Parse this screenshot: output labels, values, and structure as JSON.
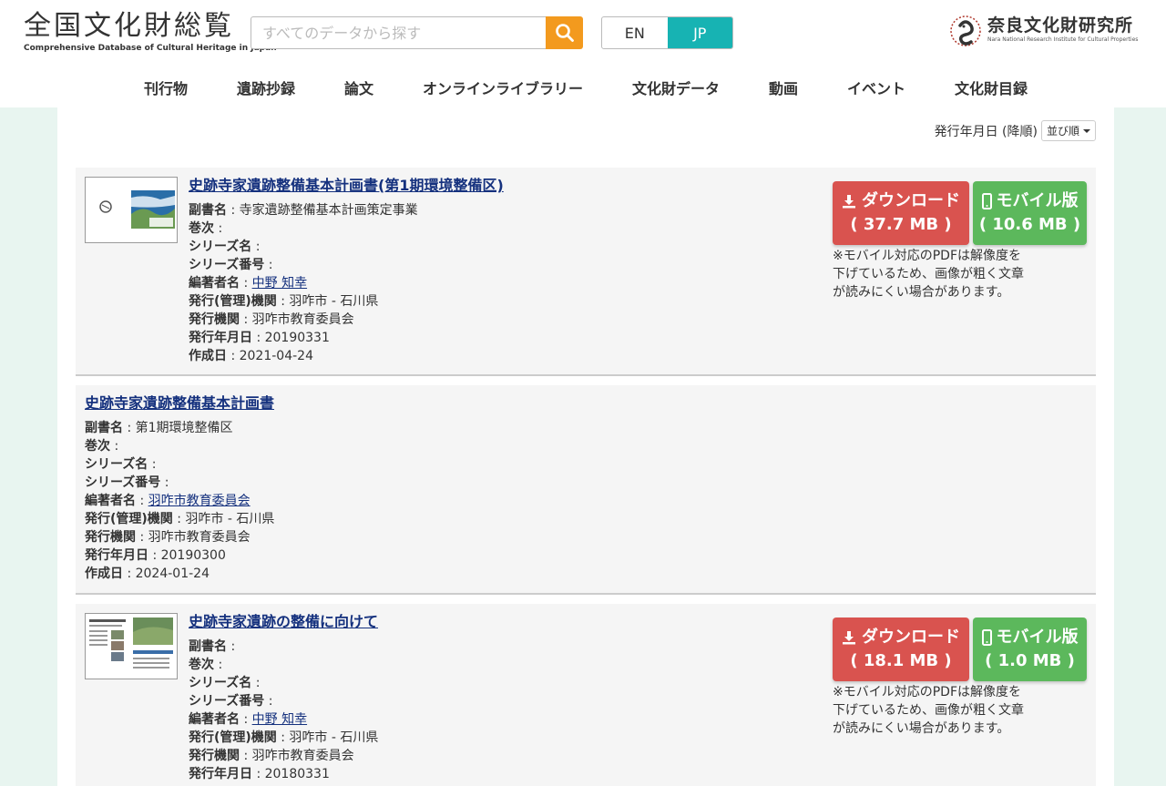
{
  "header": {
    "logo_title": "全国文化財総覧",
    "logo_subtitle": "Comprehensive Database of Cultural Heritage in Japan",
    "search_placeholder": "すべてのデータから探す",
    "lang_en": "EN",
    "lang_jp": "JP",
    "institute_name": "奈良文化財研究所",
    "institute_sub": "Nara National Research Institute for Cultural Properties"
  },
  "nav": [
    "刊行物",
    "遺跡抄録",
    "論文",
    "オンラインライブラリー",
    "文化財データ",
    "動画",
    "イベント",
    "文化財目録"
  ],
  "sort": {
    "label": "発行年月日 (降順)",
    "button": "並び順"
  },
  "field_labels": {
    "subtitle": "副書名",
    "volume": "巻次",
    "series": "シリーズ名",
    "series_no": "シリーズ番号",
    "author": "編著者名",
    "org": "発行(管理)機関",
    "publisher": "発行機関",
    "date": "発行年月日",
    "created": "作成日"
  },
  "download_label": "ダウンロード",
  "mobile_label": "モバイル版",
  "mobile_note": "※モバイル対応のPDFは解像度を下げているため、画像が粗く文章が読みにくい場合があります。",
  "results": [
    {
      "title": "史跡寺家遺跡整備基本計画書(第1期環境整備区)",
      "subtitle": " : 寺家遺跡整備基本計画策定事業",
      "volume": " :",
      "series": " :",
      "series_no": " :",
      "author": "中野 知幸",
      "org": " : 羽咋市 - 石川県",
      "publisher": " : 羽咋市教育委員会",
      "date": " : 20190331",
      "created": " : 2021-04-24",
      "download_size": "( 37.7 MB )",
      "mobile_size": "( 10.6 MB )"
    },
    {
      "title": "史跡寺家遺跡整備基本計画書",
      "subtitle": " : 第1期環境整備区",
      "volume": " :",
      "series": " :",
      "series_no": " :",
      "author": "羽咋市教育委員会",
      "org": " : 羽咋市 - 石川県",
      "publisher": " : 羽咋市教育委員会",
      "date": " : 20190300",
      "created": " : 2024-01-24"
    },
    {
      "title": "史跡寺家遺跡の整備に向けて",
      "subtitle": " :",
      "volume": " :",
      "series": " :",
      "series_no": " :",
      "author": "中野 知幸",
      "org": " : 羽咋市 - 石川県",
      "publisher": " : 羽咋市教育委員会",
      "date": " : 20180331",
      "download_size": "( 18.1 MB )",
      "mobile_size": "( 1.0 MB )"
    }
  ],
  "colors": {
    "accent_teal": "#17b3b3",
    "search_orange": "#f39a1e",
    "download_red": "#d9534f",
    "mobile_green": "#5cb85c",
    "link_navy": "#15317e"
  }
}
